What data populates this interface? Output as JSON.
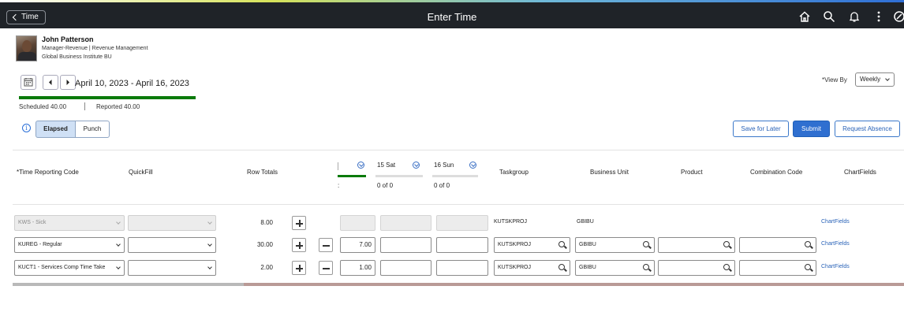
{
  "header": {
    "back_label": "Time",
    "title": "Enter Time"
  },
  "employee": {
    "name": "John Patterson",
    "role": "Manager-Revenue | Revenue Management",
    "org": "Global Business Institute BU"
  },
  "period": {
    "range": "April 10, 2023 - April 16, 2023",
    "scheduled": "Scheduled 40.00",
    "reported": "Reported 40.00",
    "progress": 1.0
  },
  "view_by": {
    "label": "*View By",
    "value": "Weekly"
  },
  "mode": {
    "elapsed": "Elapsed",
    "punch": "Punch"
  },
  "actions": {
    "save_later": "Save for Later",
    "submit": "Submit",
    "request_absence": "Request Absence"
  },
  "columns": {
    "trc": "*Time Reporting Code",
    "quickfill": "QuickFill",
    "row_totals": "Row Totals",
    "taskgroup": "Taskgroup",
    "business_unit": "Business Unit",
    "product": "Product",
    "combination_code": "Combination Code",
    "chartfields": "ChartFields"
  },
  "days": [
    {
      "label": "15 Sat",
      "sub": "0 of 0"
    },
    {
      "label": "16 Sun",
      "sub": "0 of 0"
    }
  ],
  "rows": [
    {
      "trc": "KWS - Sick",
      "total": "8.00",
      "hours": "",
      "taskgroup": "KUTSKPROJ",
      "bu": "GBIBU",
      "chartfields": "ChartFields"
    },
    {
      "trc": "KUREG - Regular",
      "total": "30.00",
      "hours": "7.00",
      "taskgroup": "KUTSKPROJ",
      "bu": "GBIBU",
      "chartfields": "ChartFields"
    },
    {
      "trc": "KUCT1 - Services Comp Time Take",
      "total": "2.00",
      "hours": "1.00",
      "taskgroup": "KUTSKPROJ",
      "bu": "GBIBU",
      "chartfields": "ChartFields"
    }
  ],
  "colors": {
    "header_bg": "#1f2328",
    "accent": "#2f6fd0",
    "progress": "#0a7a0a"
  }
}
